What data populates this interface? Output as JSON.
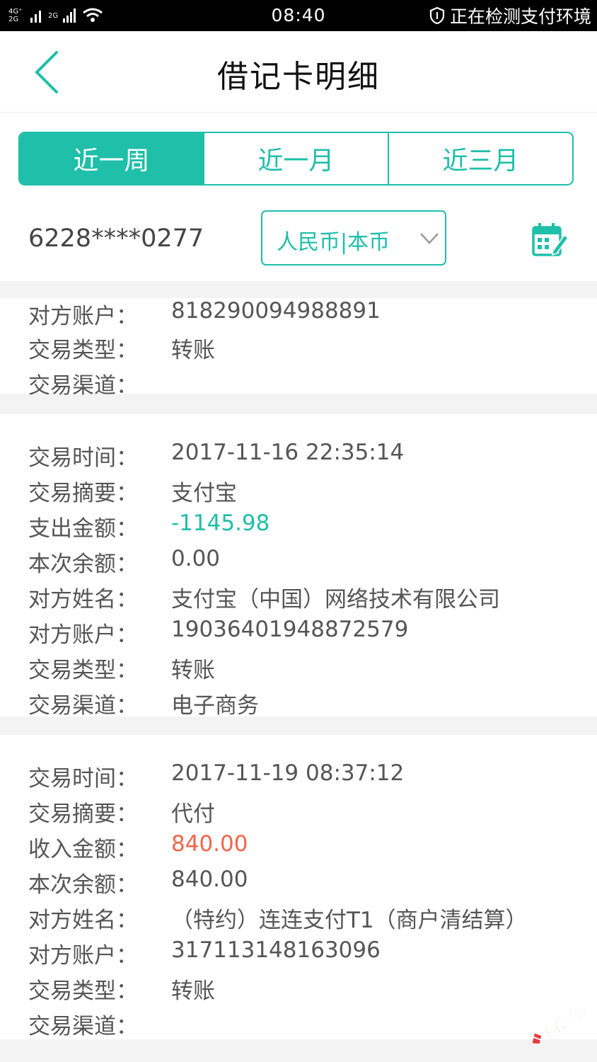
{
  "status_bar": {
    "network_top": "4G⁺",
    "network_bottom": "2G",
    "network_secondary": "2G",
    "time": "08:40",
    "security_text": "正在检测支付环境",
    "icons": [
      "signal-icon",
      "wifi-icon",
      "shield-icon"
    ]
  },
  "header": {
    "title": "借记卡明细",
    "back_icon": "chevron-left-icon"
  },
  "tabs": [
    {
      "label": "近一周",
      "active": true
    },
    {
      "label": "近一月",
      "active": false
    },
    {
      "label": "近三月",
      "active": false
    }
  ],
  "account": {
    "card_number": "6228****0277",
    "currency_selected": "人民币|本币",
    "calendar_icon": "calendar-edit-icon"
  },
  "transactions": [
    {
      "fields": [
        {
          "label": "对方账户：",
          "value": "818290094988891",
          "type": "normal"
        },
        {
          "label": "交易类型：",
          "value": "转账",
          "type": "normal"
        },
        {
          "label": "交易渠道：",
          "value": "",
          "type": "normal"
        }
      ]
    },
    {
      "fields": [
        {
          "label": "交易时间：",
          "value": "2017-11-16 22:35:14",
          "type": "normal"
        },
        {
          "label": "交易摘要：",
          "value": "支付宝",
          "type": "normal"
        },
        {
          "label": "支出金额：",
          "value": "-1145.98",
          "type": "out"
        },
        {
          "label": "本次余额：",
          "value": "0.00",
          "type": "normal"
        },
        {
          "label": "对方姓名：",
          "value": "支付宝（中国）网络技术有限公司",
          "type": "normal"
        },
        {
          "label": "对方账户：",
          "value": "19036401948872579",
          "type": "normal"
        },
        {
          "label": "交易类型：",
          "value": "转账",
          "type": "normal"
        },
        {
          "label": "交易渠道：",
          "value": "电子商务",
          "type": "normal"
        }
      ]
    },
    {
      "fields": [
        {
          "label": "交易时间：",
          "value": "2017-11-19 08:37:12",
          "type": "normal"
        },
        {
          "label": "交易摘要：",
          "value": "代付",
          "type": "normal"
        },
        {
          "label": "收入金额：",
          "value": "840.00",
          "type": "in"
        },
        {
          "label": "本次余额：",
          "value": "840.00",
          "type": "normal"
        },
        {
          "label": "对方姓名：",
          "value": "（特约）连连支付T1（商户清结算）",
          "type": "normal"
        },
        {
          "label": "对方账户：",
          "value": "317113148163096",
          "type": "normal"
        },
        {
          "label": "交易类型：",
          "value": "转账",
          "type": "normal"
        },
        {
          "label": "交易渠道：",
          "value": "",
          "type": "normal"
        }
      ]
    }
  ],
  "watermark": {
    "text": "卡农社区"
  },
  "colors": {
    "accent": "#1fbfa9",
    "income": "#f2664a",
    "text": "#555555"
  }
}
